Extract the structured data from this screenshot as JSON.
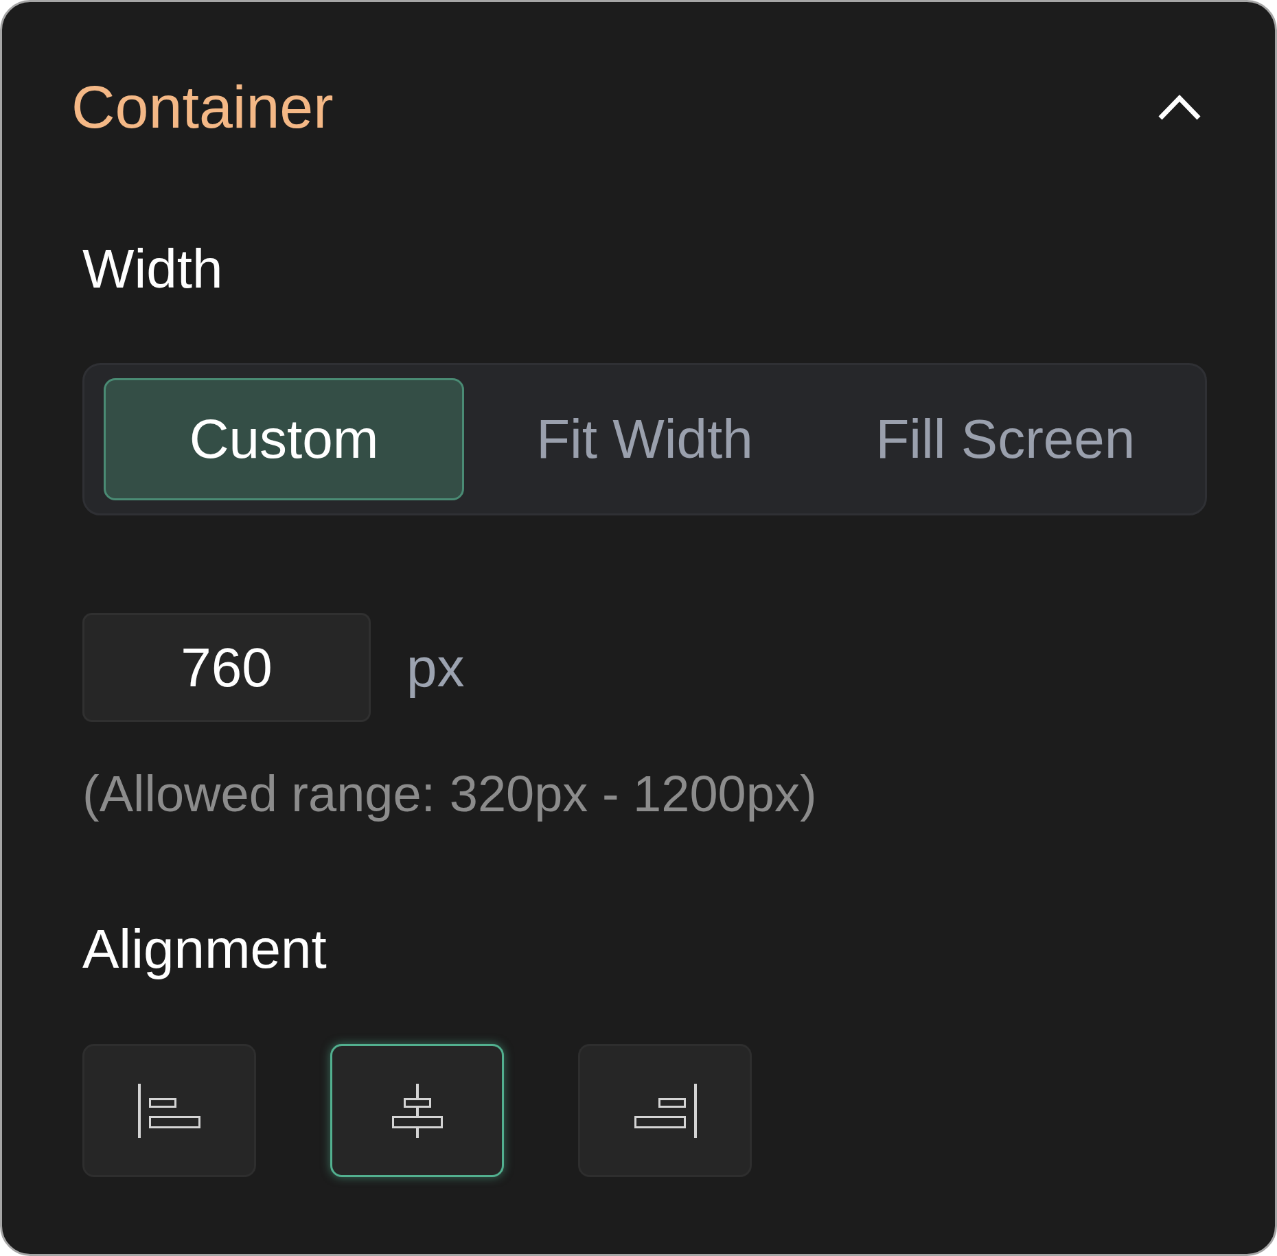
{
  "panel": {
    "title": "Container",
    "expanded": true
  },
  "width": {
    "label": "Width",
    "modes": [
      {
        "label": "Custom",
        "selected": true
      },
      {
        "label": "Fit Width",
        "selected": false
      },
      {
        "label": "Fill Screen",
        "selected": false
      }
    ],
    "value": "760",
    "unit": "px",
    "hint": "(Allowed range: 320px - 1200px)"
  },
  "alignment": {
    "label": "Alignment",
    "options": [
      {
        "kind": "left",
        "selected": false
      },
      {
        "kind": "center",
        "selected": true
      },
      {
        "kind": "right",
        "selected": false
      }
    ]
  }
}
